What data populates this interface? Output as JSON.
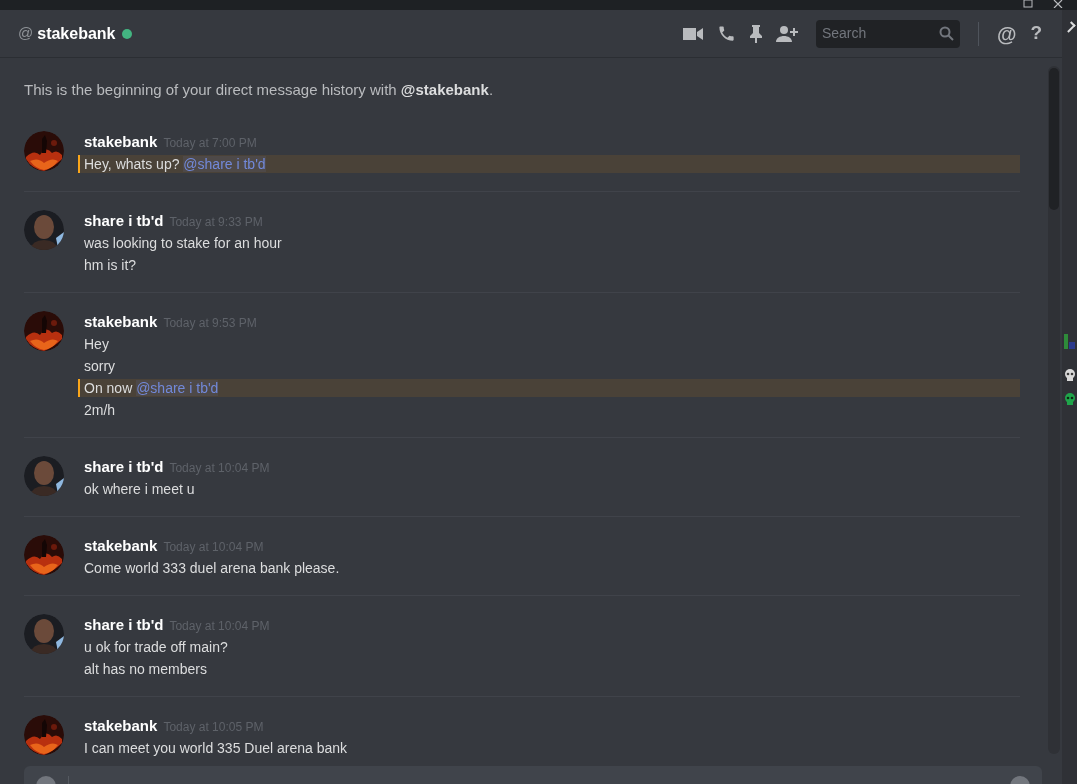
{
  "header": {
    "at_sign": "@",
    "channel": "stakebank",
    "online": true,
    "search": {
      "placeholder": "Search"
    },
    "mention_icon": "@",
    "help_icon": "?"
  },
  "intro": {
    "text": "This is the beginning of your direct message history with ",
    "user": "@stakebank",
    "end": "."
  },
  "messages": [
    {
      "author": "stakebank",
      "time": "Today at 7:00 PM",
      "avatar": {
        "kind": "fire"
      },
      "lines": [
        {
          "text": "Hey, whats up? ",
          "mention": "@share i tb'd",
          "highlighted": true
        }
      ]
    },
    {
      "author": "share i tb'd",
      "time": "Today at 9:33 PM",
      "avatar": {
        "kind": "person"
      },
      "lines": [
        {
          "text": "was looking to stake for an hour",
          "highlighted": false
        },
        {
          "text": "hm is it?",
          "highlighted": false
        }
      ]
    },
    {
      "author": "stakebank",
      "time": "Today at 9:53 PM",
      "avatar": {
        "kind": "fire"
      },
      "lines": [
        {
          "text": "Hey",
          "highlighted": false
        },
        {
          "text": "sorry",
          "highlighted": false
        },
        {
          "text": "On now ",
          "mention": "@share i tb'd",
          "highlighted": true
        },
        {
          "text": "2m/h",
          "highlighted": false
        }
      ]
    },
    {
      "author": "share i tb'd",
      "time": "Today at 10:04 PM",
      "avatar": {
        "kind": "person"
      },
      "lines": [
        {
          "text": "ok where i meet u",
          "highlighted": false
        }
      ]
    },
    {
      "author": "stakebank",
      "time": "Today at 10:04 PM",
      "avatar": {
        "kind": "fire"
      },
      "lines": [
        {
          "text": "Come world 333 duel arena bank please.",
          "highlighted": false
        }
      ]
    },
    {
      "author": "share i tb'd",
      "time": "Today at 10:04 PM",
      "avatar": {
        "kind": "person"
      },
      "lines": [
        {
          "text": "u ok for trade off main?",
          "highlighted": false
        },
        {
          "text": "alt has no members",
          "highlighted": false
        }
      ]
    },
    {
      "author": "stakebank",
      "time": "Today at 10:05 PM",
      "avatar": {
        "kind": "fire"
      },
      "lines": [
        {
          "text": "I can meet you world 335 Duel arena bank",
          "highlighted": false
        }
      ]
    }
  ]
}
